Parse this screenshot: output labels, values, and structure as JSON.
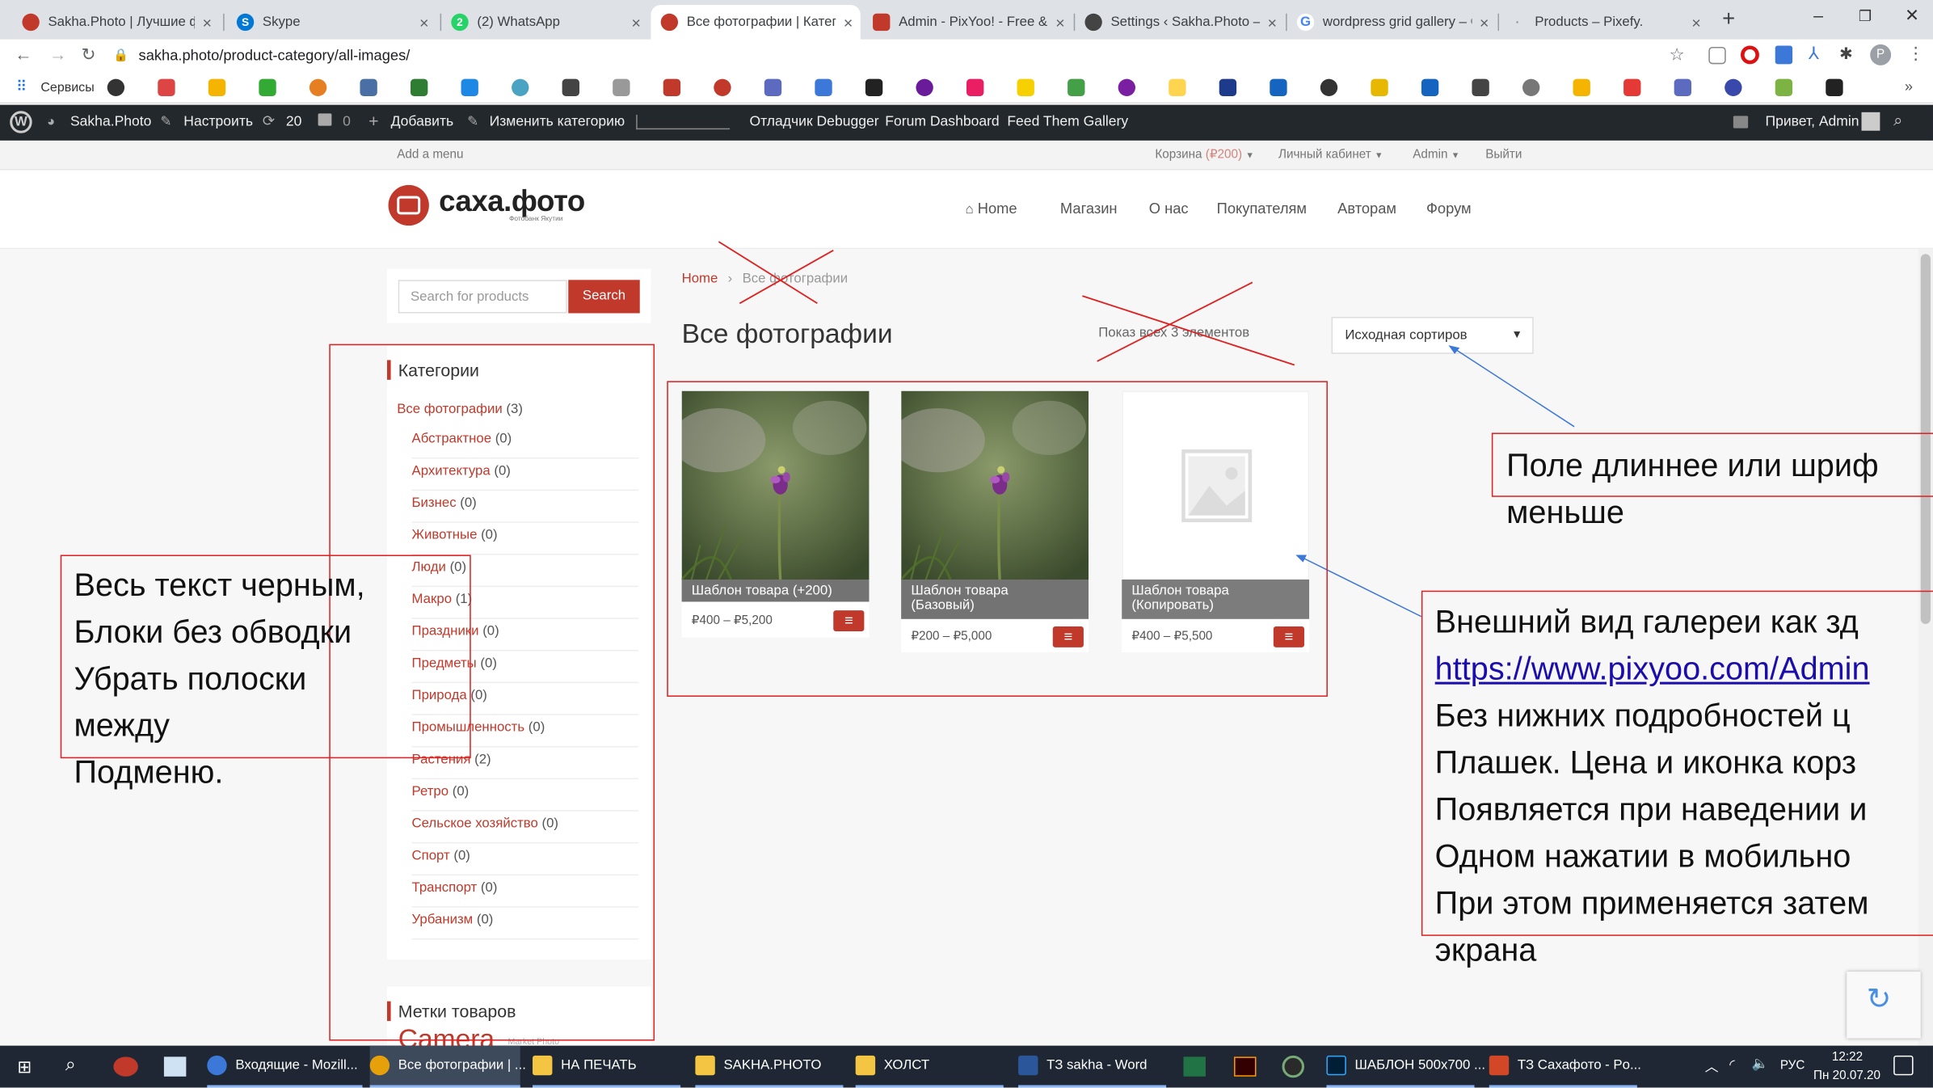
{
  "browser": {
    "tabs": [
      {
        "label": "Sakha.Photo | Лучшие фото",
        "color": "#c0392b",
        "active": false
      },
      {
        "label": "Skype",
        "color": "#0078d4",
        "active": false
      },
      {
        "label": "(2) WhatsApp",
        "color": "#25d366",
        "active": false
      },
      {
        "label": "Все фотографии | Категори",
        "color": "#c0392b",
        "active": true
      },
      {
        "label": "Admin - PixYoo! - Free & Pr",
        "color": "#c0392b",
        "active": false
      },
      {
        "label": "Settings ‹ Sakha.Photo — W",
        "color": "#444444",
        "active": false
      },
      {
        "label": "wordpress grid gallery – Go",
        "color": "#4285f4",
        "active": false
      },
      {
        "label": "Products – Pixefy.",
        "color": "#888888",
        "active": false
      }
    ],
    "new_tab": "+",
    "url": "sakha.photo/product-category/all-images/",
    "bookmarks_label": "Сервисы"
  },
  "wp_admin_bar": {
    "site": "Sakha.Photo",
    "customize": "Настроить",
    "updates": "20",
    "comments": "0",
    "add": "Добавить",
    "edit": "Изменить категорию",
    "debugger": "Отладчик Debugger",
    "forum": "Forum Dashboard",
    "feed": "Feed Them Gallery",
    "greeting": "Привет, Admin"
  },
  "topmenu": {
    "add_menu": "Add a menu",
    "cart": "Корзина",
    "cart_amount": "(₽200)",
    "account": "Личный кабинет",
    "admin": "Admin",
    "logout": "Выйти"
  },
  "header": {
    "logo_text": "саха.фото",
    "logo_sub": "Фотобанк Якутии",
    "nav": [
      "Home",
      "Магазин",
      "О нас",
      "Покупателям",
      "Авторам",
      "Форум"
    ]
  },
  "sidebar": {
    "search_placeholder": "Search for products",
    "search_button": "Search",
    "categories_title": "Категории",
    "parent": {
      "name": "Все фотографии",
      "count": "(3)"
    },
    "categories": [
      {
        "name": "Абстрактное",
        "count": "(0)"
      },
      {
        "name": "Архитектура",
        "count": "(0)"
      },
      {
        "name": "Бизнес",
        "count": "(0)"
      },
      {
        "name": "Животные",
        "count": "(0)"
      },
      {
        "name": "Люди",
        "count": "(0)"
      },
      {
        "name": "Макро",
        "count": "(1)"
      },
      {
        "name": "Праздники",
        "count": "(0)"
      },
      {
        "name": "Предметы",
        "count": "(0)"
      },
      {
        "name": "Природа",
        "count": "(0)"
      },
      {
        "name": "Промышленность",
        "count": "(0)"
      },
      {
        "name": "Растения",
        "count": "(2)"
      },
      {
        "name": "Ретро",
        "count": "(0)"
      },
      {
        "name": "Сельское хозяйство",
        "count": "(0)"
      },
      {
        "name": "Спорт",
        "count": "(0)"
      },
      {
        "name": "Транспорт",
        "count": "(0)"
      },
      {
        "name": "Урбанизм",
        "count": "(0)"
      }
    ],
    "tags_title": "Метки товаров",
    "tag_big": "Camera",
    "tag_small": "Market Photo"
  },
  "main": {
    "breadcrumb_home": "Home",
    "breadcrumb_current": "Все фотографии",
    "page_title": "Все фотографии",
    "result_count": "Показ всех 3 элементов",
    "sort_value": "Исходная сортиров",
    "products": [
      {
        "title": "Шаблон товара (+200)",
        "price": "₽400 – ₽5,200",
        "image": "flower"
      },
      {
        "title": "Шаблон товара (Базовый)",
        "price": "₽200 – ₽5,000",
        "image": "flower"
      },
      {
        "title": "Шаблон товара (Копировать)",
        "price": "₽400 – ₽5,500",
        "image": "placeholder"
      }
    ]
  },
  "annotations": {
    "left_note": [
      "Весь текст черным,",
      "Блоки без обводки",
      "Убрать полоски",
      "между",
      "Подменю."
    ],
    "sort_note": [
      "Поле длиннее или шриф",
      "меньше"
    ],
    "gallery_note": [
      "Внешний вид галереи как зд",
      "https://www.pixyoo.com/Admin",
      "Без нижних подробностей ц",
      "Плашек. Цена и иконка корз",
      "Появляется при наведении и",
      "Одном нажатии в мобильно",
      "При этом применяется затем",
      "экрана"
    ],
    "line_color": "#e02020"
  },
  "taskbar": {
    "items": [
      "Входящие - Mozill...",
      "Все фотографии | ...",
      "НА ПЕЧАТЬ",
      "SAKHA.PHOTO",
      "ХОЛСТ",
      "ТЗ sakha - Word",
      "ШАБЛОН 500x700 ...",
      "ТЗ Сахафото - Po..."
    ],
    "lang": "РУС",
    "time": "12:22",
    "date": "Пн 20.07.20"
  },
  "colors": {
    "accent": "#c0392b",
    "admin_bar": "#23282d",
    "taskbar": "#1e2733"
  }
}
